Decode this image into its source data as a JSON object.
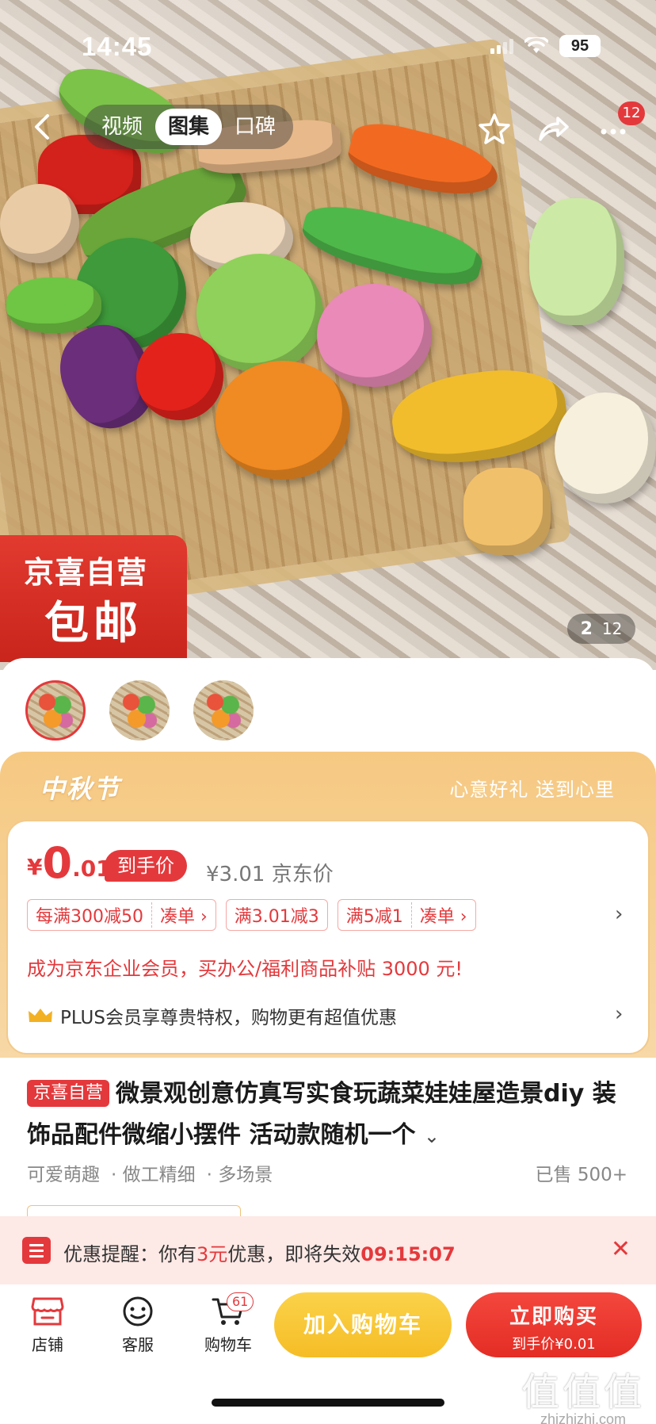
{
  "status_bar": {
    "time": "14:45",
    "battery": "95"
  },
  "hero": {
    "tabs": [
      {
        "label": "视频",
        "active": false
      },
      {
        "label": "图集",
        "active": true
      },
      {
        "label": "口碑",
        "active": false
      }
    ],
    "more_badge": "12",
    "promo_tag": {
      "line1": "京喜自营",
      "line2": "包邮"
    },
    "page_indicator": {
      "current": "2",
      "total": "12"
    }
  },
  "festival": {
    "title": "中秋节",
    "slogan": "心意好礼 送到心里"
  },
  "price": {
    "currency": "¥",
    "integer": "0",
    "decimal": ".01",
    "chip": "到手价",
    "original": "¥3.01 京东价"
  },
  "coupons": [
    {
      "text": "每满300减50",
      "action": "凑单 ›"
    },
    {
      "text": "满3.01减3",
      "action": ""
    },
    {
      "text": "满5减1",
      "action": "凑单 ›"
    }
  ],
  "enterprise_text": "成为京东企业会员，买办公/福利商品补贴 3000 元!",
  "plus_text": "PLUS会员享尊贵特权，购物更有超值优惠",
  "product": {
    "tag": "京喜自营",
    "title": "微景观创意仿真写实食玩蔬菜娃娃屋造景diy 装饰品配件微缩小摆件 活动款随机一个",
    "features": [
      "可爱萌趣",
      "· 做工精细",
      "· 多场景"
    ],
    "sold": "已售 500+"
  },
  "reminder": {
    "prefix": "优惠提醒：你有",
    "amount": "3元",
    "middle": "优惠，即将失效",
    "countdown": "09:15:07"
  },
  "bottom_bar": {
    "store": "店铺",
    "service": "客服",
    "cart": "购物车",
    "cart_count": "61",
    "add_to_cart": "加入购物车",
    "buy_now": "立即购买",
    "buy_price": "到手价¥0.01"
  },
  "watermark": {
    "big": "值值值",
    "small": "zhizhizhi.com"
  },
  "colors": {
    "accent": "#e4393c",
    "cart_button": "#f5bd26",
    "festival_bg": "#f6c982"
  }
}
